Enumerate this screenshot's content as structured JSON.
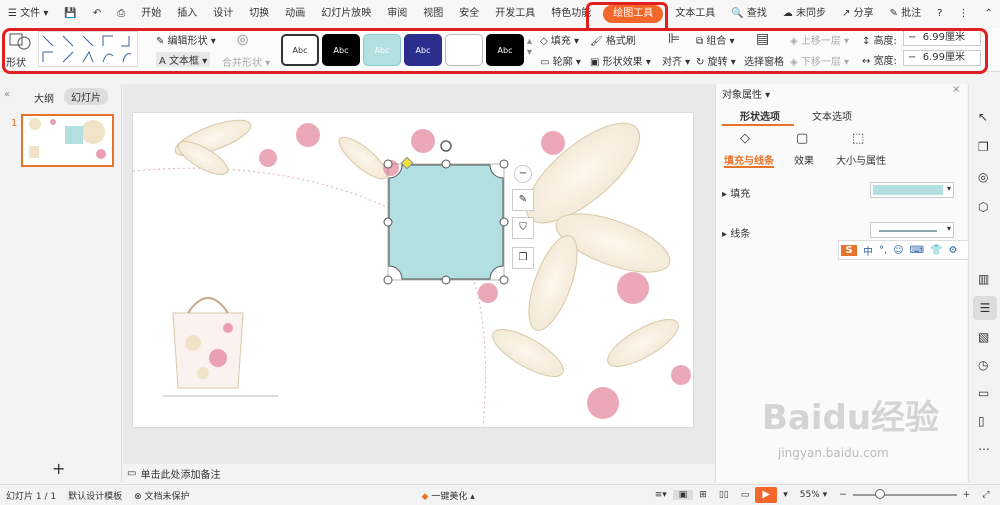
{
  "menubar": {
    "file": "文件",
    "tabs": [
      "开始",
      "插入",
      "设计",
      "切换",
      "动画",
      "幻灯片放映",
      "审阅",
      "视图",
      "安全",
      "开发工具",
      "特色功能"
    ],
    "active_tab": "绘图工具",
    "text_tool_tab": "文本工具",
    "search": "查找",
    "sync": "未同步",
    "share": "分享",
    "annotate": "批注"
  },
  "ribbon": {
    "shape": "形状",
    "edit_shape": "编辑形状",
    "text_box": "文本框",
    "merge_shape": "合并形状",
    "style_label": "Abc",
    "fill": "填充",
    "format_brush": "格式刷",
    "outline": "轮廓",
    "shape_effect": "形状效果",
    "align": "对齐",
    "group": "组合",
    "rotate": "旋转",
    "selection_pane": "选择窗格",
    "bring_forward": "上移一层",
    "send_backward": "下移一层",
    "height_label": "高度:",
    "height_value": "6.99厘米",
    "width_label": "宽度:",
    "width_value": "6.99厘米",
    "colors": {
      "accent": "#f4672a",
      "style1": "#ffffff",
      "style2": "#000000",
      "style3": "#b2dfe0",
      "style4": "#2b2e8c",
      "style5": "#ffffff",
      "style6": "#000000"
    }
  },
  "left_panel": {
    "outline_tab": "大纲",
    "slides_tab": "幻灯片",
    "slide_number": "1",
    "add_icon": "plus-icon"
  },
  "slide": {
    "shape_fill": "#b2dfe0",
    "notes_placeholder": "单击此处添加备注"
  },
  "right_panel": {
    "title": "对象属性",
    "tab_shape": "形状选项",
    "tab_text": "文本选项",
    "sub_fill_line": "填充与线条",
    "sub_effect": "效果",
    "sub_size": "大小与属性",
    "fill_label": "填充",
    "line_label": "线条",
    "fill_color": "#b2dfe0"
  },
  "ime_bar": {
    "items": [
      "中",
      "°,",
      "☺",
      "⌨",
      "👕",
      "⚙"
    ]
  },
  "status": {
    "slide_info": "幻灯片 1 / 1",
    "template": "默认设计模板",
    "doc_protect": "文档未保护",
    "beautify": "一键美化",
    "zoom": "55%"
  },
  "watermark": {
    "text": "Baidu经验",
    "url": "jingyan.baidu.com"
  }
}
